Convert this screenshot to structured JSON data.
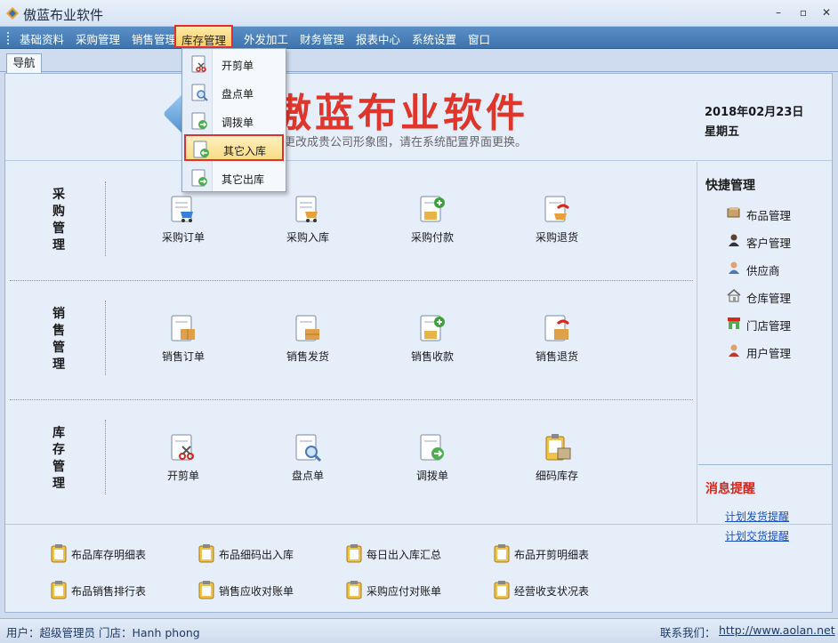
{
  "window": {
    "title": "傲蓝布业软件",
    "minimize": "–",
    "maximize": "▫",
    "close": "✕"
  },
  "menu": [
    "基础资料",
    "采购管理",
    "销售管理",
    "库存管理",
    "外发加工",
    "财务管理",
    "报表中心",
    "系统设置",
    "窗口"
  ],
  "tabs": [
    "导航"
  ],
  "dropdown": [
    "开剪单",
    "盘点单",
    "调拨单",
    "其它入库",
    "其它出库"
  ],
  "banner": {
    "title": "傲蓝布业软件",
    "subtitle": "以更改成贵公司形象图，请在系统配置界面更换。",
    "date": "2018年02月23日",
    "weekday": "星期五"
  },
  "sections": {
    "purchase": {
      "label": "采购管理",
      "tiles": [
        "采购订单",
        "采购入库",
        "采购付款",
        "采购退货"
      ]
    },
    "sales": {
      "label": "销售管理",
      "tiles": [
        "销售订单",
        "销售发货",
        "销售收款",
        "销售退货"
      ]
    },
    "stock": {
      "label": "库存管理",
      "tiles": [
        "开剪单",
        "盘点单",
        "调拨单",
        "细码库存"
      ]
    }
  },
  "quick": {
    "title": "快捷管理",
    "items": [
      "布品管理",
      "客户管理",
      "供应商",
      "仓库管理",
      "门店管理",
      "用户管理"
    ]
  },
  "messages": {
    "title": "消息提醒",
    "links": [
      "计划发货提醒",
      "计划交货提醒"
    ]
  },
  "reports": [
    "布品库存明细表",
    "布品细码出入库",
    "每日出入库汇总",
    "布品开剪明细表",
    "布品销售排行表",
    "销售应收对账单",
    "采购应付对账单",
    "经营收支状况表"
  ],
  "status": {
    "user": "用户：超级管理员  门店：Hanh phong",
    "contact": "联系我们：",
    "url": "http://www.aolan.net"
  },
  "colors": {
    "menubar": "#4a80bb",
    "highlight": "#e03030",
    "banner_title": "#e0352b",
    "link": "#1a4fc4"
  }
}
